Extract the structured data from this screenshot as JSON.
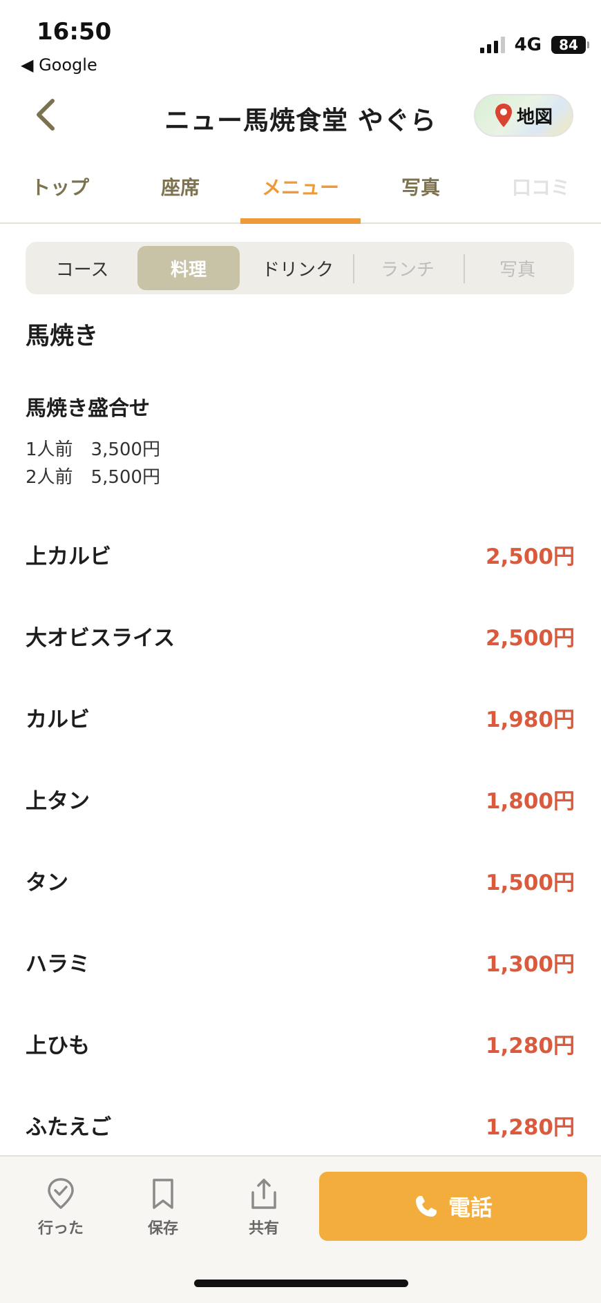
{
  "status_bar": {
    "time": "16:50",
    "back_app": "◀ Google",
    "network": "4G",
    "battery": "84"
  },
  "header": {
    "title": "ニュー馬焼食堂 やぐら",
    "map_label": "地図"
  },
  "tabs": [
    {
      "label": "トップ"
    },
    {
      "label": "座席"
    },
    {
      "label": "メニュー"
    },
    {
      "label": "写真"
    },
    {
      "label": "口コミ"
    }
  ],
  "menu_filters": [
    {
      "label": "コース"
    },
    {
      "label": "料理"
    },
    {
      "label": "ドリンク"
    },
    {
      "label": "ランチ"
    },
    {
      "label": "写真"
    }
  ],
  "section": {
    "category": "馬焼き",
    "combo": {
      "name": "馬焼き盛合せ",
      "lines": [
        "1人前　3,500円",
        "2人前　5,500円"
      ]
    },
    "items": [
      {
        "name": "上カルビ",
        "price": "2,500円"
      },
      {
        "name": "大オビスライス",
        "price": "2,500円"
      },
      {
        "name": "カルビ",
        "price": "1,980円"
      },
      {
        "name": "上タン",
        "price": "1,800円"
      },
      {
        "name": "タン",
        "price": "1,500円"
      },
      {
        "name": "ハラミ",
        "price": "1,300円"
      },
      {
        "name": "上ひも",
        "price": "1,280円"
      },
      {
        "name": "ふたえご",
        "price": "1,280円"
      }
    ]
  },
  "bottom_bar": {
    "visited_label": "行った",
    "save_label": "保存",
    "share_label": "共有",
    "call_label": "電話"
  },
  "colors": {
    "accent_orange": "#ef9a3a",
    "price_red": "#d95a3c",
    "call_button": "#f3ad3d",
    "segment_active": "#c8c2a6"
  }
}
